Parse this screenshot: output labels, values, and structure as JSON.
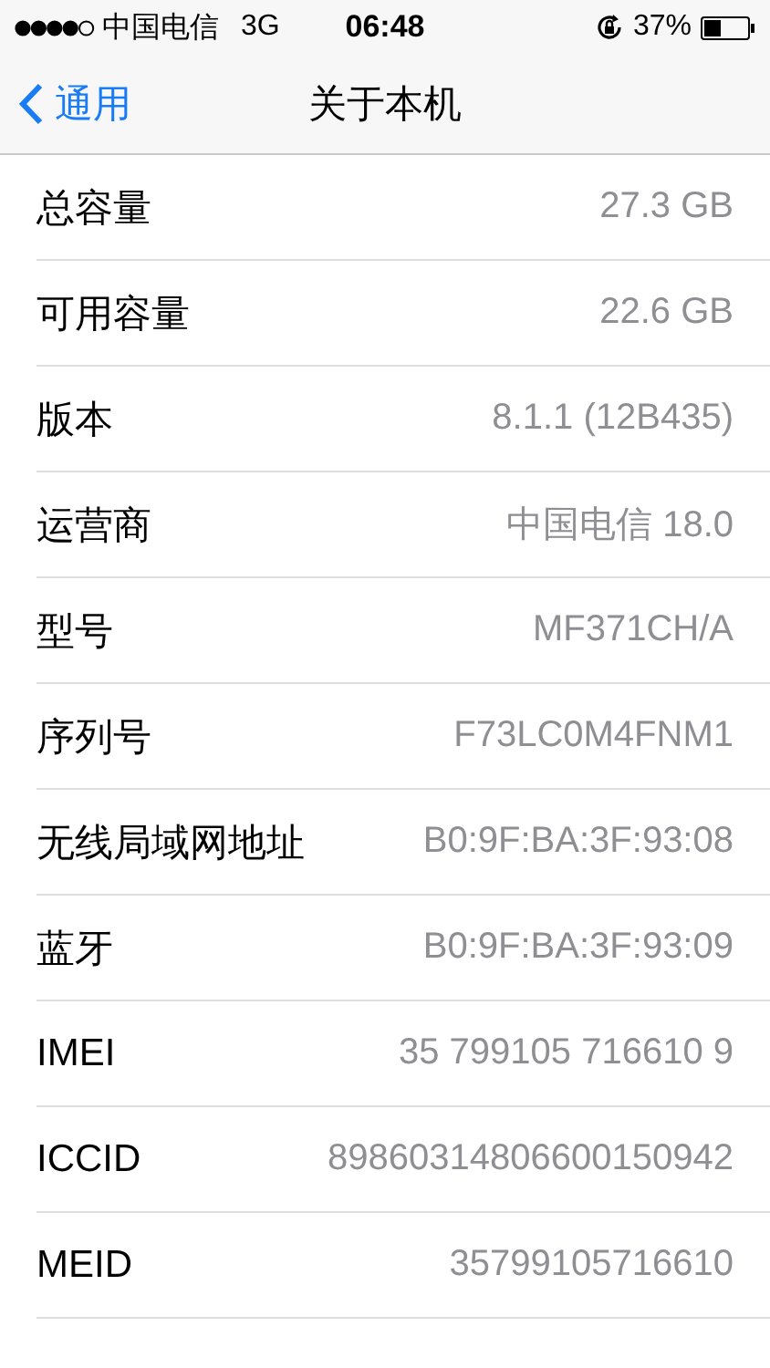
{
  "status_bar": {
    "carrier": "中国电信",
    "network": "3G",
    "time": "06:48",
    "battery": "37%"
  },
  "nav": {
    "back": "通用",
    "title": "关于本机"
  },
  "rows": [
    {
      "label": "总容量",
      "value": "27.3 GB"
    },
    {
      "label": "可用容量",
      "value": "22.6 GB"
    },
    {
      "label": "版本",
      "value": "8.1.1 (12B435)"
    },
    {
      "label": "运营商",
      "value": "中国电信 18.0"
    },
    {
      "label": "型号",
      "value": "MF371CH/A"
    },
    {
      "label": "序列号",
      "value": "F73LC0M4FNM1"
    },
    {
      "label": "无线局域网地址",
      "value": "B0:9F:BA:3F:93:08"
    },
    {
      "label": "蓝牙",
      "value": "B0:9F:BA:3F:93:09"
    },
    {
      "label": "IMEI",
      "value": "35 799105 716610 9"
    },
    {
      "label": "ICCID",
      "value": "89860314806600150942"
    },
    {
      "label": "MEID",
      "value": "35799105716610"
    }
  ]
}
